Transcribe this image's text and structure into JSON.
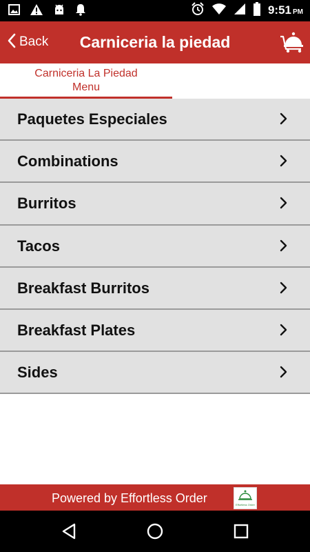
{
  "status_bar": {
    "time": "9:51",
    "period": "PM",
    "left_icons": [
      "image-icon",
      "warning-icon",
      "android-icon",
      "notification-bell-icon"
    ],
    "right_icons": [
      "alarm-icon",
      "wifi-icon",
      "signal-icon",
      "battery-icon"
    ]
  },
  "app_bar": {
    "back_label": "Back",
    "title": "Carniceria la piedad",
    "cart_icon": "service-bell-cart-icon"
  },
  "tabs": {
    "menu_line1": "Carniceria La Piedad",
    "menu_line2": "Menu"
  },
  "menu": {
    "items": [
      {
        "label": "Paquetes Especiales"
      },
      {
        "label": "Combinations"
      },
      {
        "label": "Burritos"
      },
      {
        "label": "Tacos"
      },
      {
        "label": "Breakfast Burritos"
      },
      {
        "label": "Breakfast Plates"
      },
      {
        "label": "Sides"
      }
    ]
  },
  "footer": {
    "text": "Powered by Effortless Order",
    "logo_text": "Effortless Order"
  },
  "colors": {
    "brand_red": "#c0302a",
    "list_background": "#e1e1e1",
    "divider": "#9a9a9a"
  }
}
